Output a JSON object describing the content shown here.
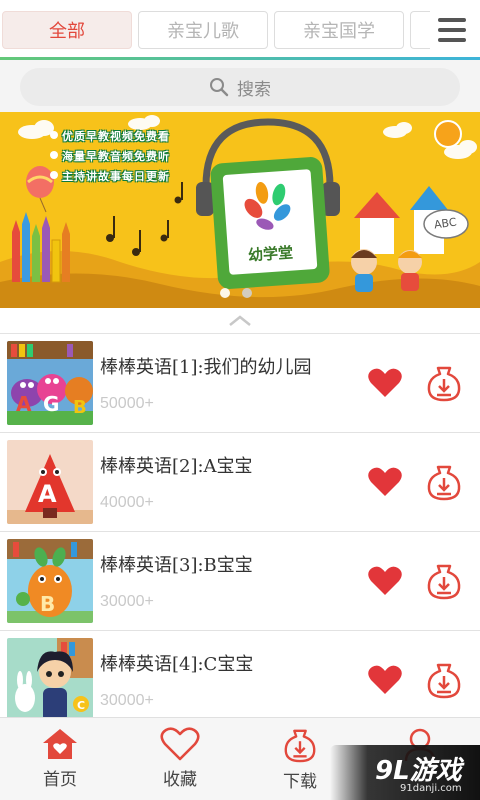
{
  "tabs": [
    {
      "label": "全部",
      "active": true
    },
    {
      "label": "亲宝儿歌",
      "active": false
    },
    {
      "label": "亲宝国学",
      "active": false
    }
  ],
  "search": {
    "label": "搜索"
  },
  "banner": {
    "lines": [
      "优质早教视频免费看",
      "海量早教音频免费听",
      "主持讲故事每日更新"
    ],
    "logo_text": "幼学堂",
    "sign_text": "ABC"
  },
  "items": [
    {
      "title": "棒棒英语[1]:我们的幼儿园",
      "plays": "50000+",
      "thumb": "blocks"
    },
    {
      "title": "棒棒英语[2]:A宝宝",
      "plays": "40000+",
      "thumb": "letter-a"
    },
    {
      "title": "棒棒英语[3]:B宝宝",
      "plays": "30000+",
      "thumb": "letter-b"
    },
    {
      "title": "棒棒英语[4]:C宝宝",
      "plays": "30000+",
      "thumb": "girl"
    }
  ],
  "bottom_nav": [
    {
      "label": "首页",
      "icon": "home-icon",
      "active": true
    },
    {
      "label": "收藏",
      "icon": "heart-icon",
      "active": false
    },
    {
      "label": "下载",
      "icon": "download-icon",
      "active": false
    },
    {
      "label": "",
      "icon": "profile-icon",
      "active": false
    }
  ],
  "watermark": {
    "main": "9L游戏",
    "sub": "91danji.com"
  },
  "colors": {
    "accent": "#e2483c",
    "banner": "#f7c21a",
    "rule_start": "#63c878",
    "rule_end": "#3db4d9"
  }
}
